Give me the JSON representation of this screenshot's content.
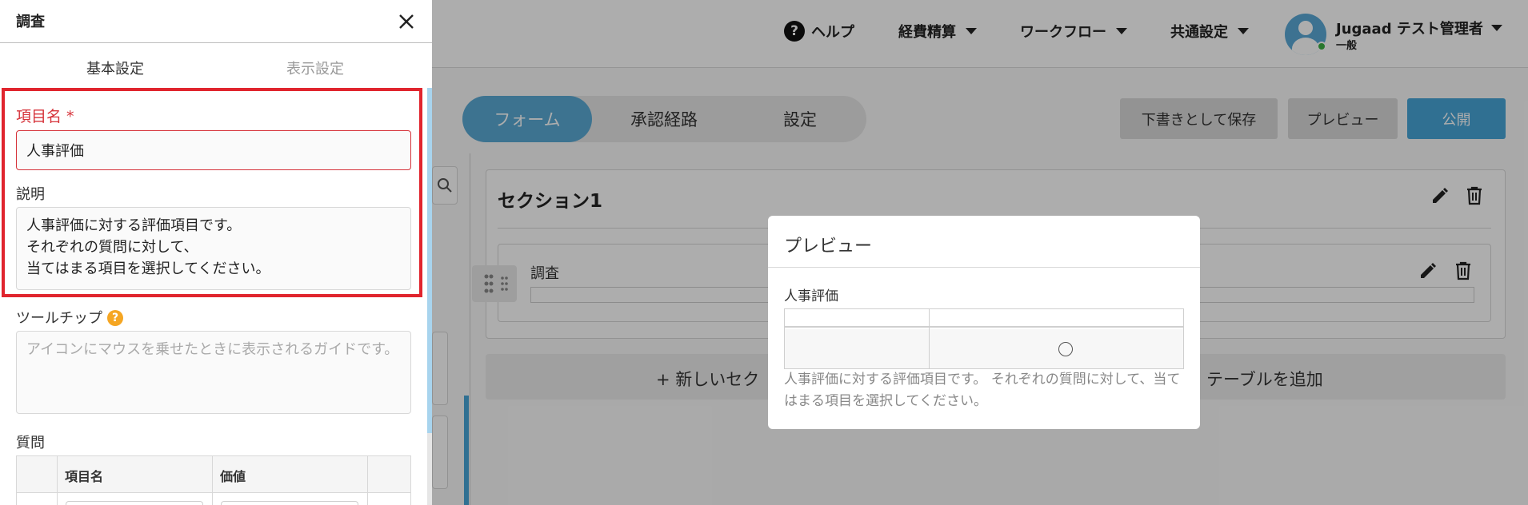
{
  "header": {
    "help": "ヘルプ",
    "menu_expense": "経費精算",
    "menu_workflow": "ワークフロー",
    "menu_common": "共通設定",
    "user_name": "Jugaad テスト管理者",
    "user_role": "一般"
  },
  "tabs": {
    "form": "フォーム",
    "approval": "承認経路",
    "settings": "設定"
  },
  "actions": {
    "save_draft": "下書きとして保存",
    "preview": "プレビュー",
    "publish": "公開"
  },
  "builder": {
    "section_title": "セクション1",
    "field_label": "調査",
    "add_section": "+ 新しいセク",
    "add_table": "テーブルを追加"
  },
  "dialog": {
    "title": "プレビュー",
    "field_name": "人事評価",
    "description": "人事評価に対する評価項目です。 それぞれの質問に対して、当てはまる項目を選択してください。"
  },
  "drawer": {
    "title": "調査",
    "tab_basic": "基本設定",
    "tab_display": "表示設定",
    "item_name_label": "項目名 *",
    "item_name_value": "人事評価",
    "description_label": "説明",
    "description_value": "人事評価に対する評価項目です。\nそれぞれの質問に対して、\n当てはまる項目を選択してください。",
    "tooltip_label": "ツールチップ",
    "tooltip_placeholder": "アイコンにマウスを乗せたときに表示されるガイドです。",
    "questions_label": "質問",
    "col_item_name": "項目名",
    "col_value": "価値"
  },
  "colors": {
    "accent": "#47a6d8",
    "required": "#d6333a",
    "highlight": "#e0252e",
    "tooltip_icon": "#f5a623",
    "online": "#3cb043"
  }
}
